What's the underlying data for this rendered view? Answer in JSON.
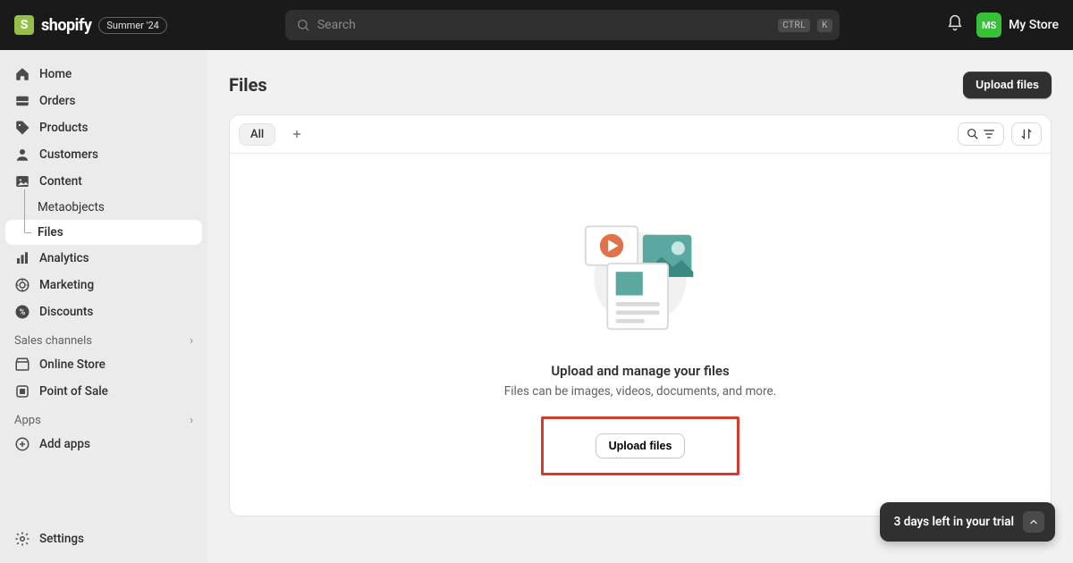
{
  "header": {
    "brand": "shopify",
    "season_badge": "Summer '24",
    "search_placeholder": "Search",
    "kbd_ctrl": "CTRL",
    "kbd_k": "K",
    "store_initials": "MS",
    "store_name": "My Store"
  },
  "sidebar": {
    "items": {
      "home": "Home",
      "orders": "Orders",
      "products": "Products",
      "customers": "Customers",
      "content": "Content",
      "metaobjects": "Metaobjects",
      "files": "Files",
      "analytics": "Analytics",
      "marketing": "Marketing",
      "discounts": "Discounts"
    },
    "sections": {
      "sales_channels": "Sales channels",
      "online_store": "Online Store",
      "point_of_sale": "Point of Sale",
      "apps": "Apps",
      "add_apps": "Add apps"
    },
    "settings": "Settings"
  },
  "page": {
    "title": "Files",
    "upload_primary": "Upload files",
    "tab_all": "All",
    "empty_title": "Upload and manage your files",
    "empty_body": "Files can be images, videos, documents, and more.",
    "upload_secondary": "Upload files"
  },
  "trial": {
    "text": "3 days left in your trial"
  }
}
